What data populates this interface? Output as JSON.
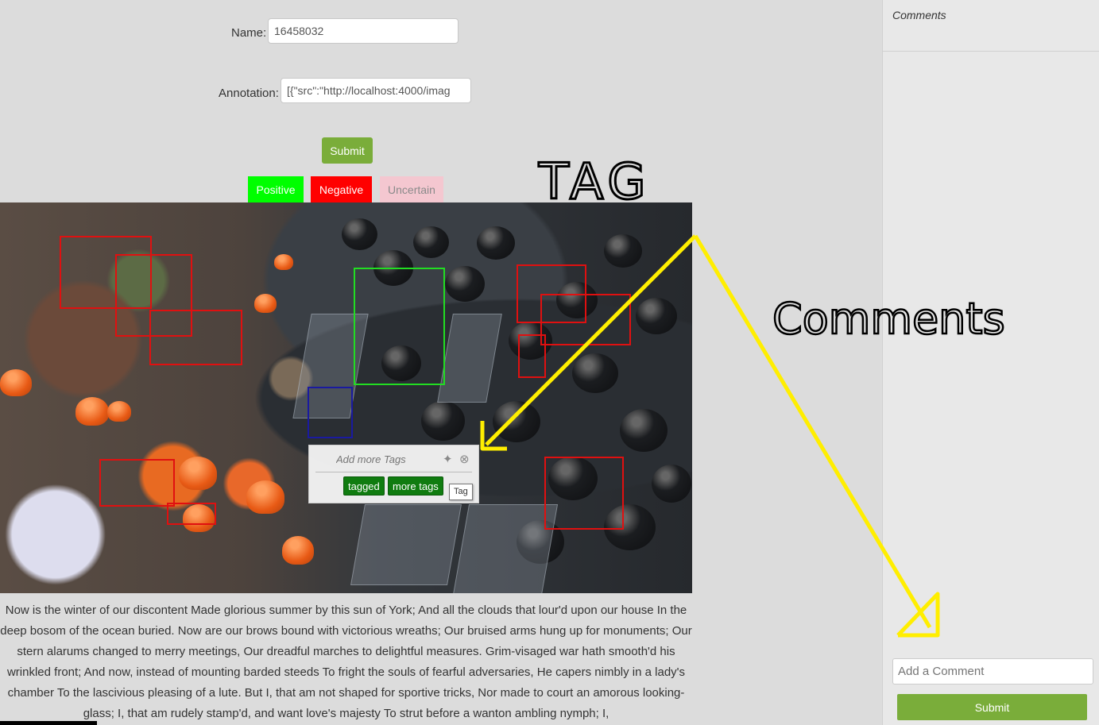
{
  "form": {
    "name_label": "Name:",
    "name_value": "16458032",
    "annotation_label": "Annotation:",
    "annotation_value": "[{\"src\":\"http://localhost:4000/imag",
    "submit_label": "Submit"
  },
  "sentiment": {
    "positive_label": "Positive",
    "negative_label": "Negative",
    "uncertain_label": "Uncertain",
    "positive_color": "#00ff00",
    "negative_color": "#ff0000",
    "uncertain_color": "#f4c7d0"
  },
  "tag_popup": {
    "placeholder": "Add more Tags",
    "tags": [
      "tagged",
      "more tags"
    ],
    "tooltip": "Tag",
    "tag_color": "#107c10"
  },
  "story": {
    "text": "Now is the winter of our discontent Made glorious summer by this sun of York; And all the clouds that lour'd upon our house In the deep bosom of the ocean buried. Now are our brows bound with victorious wreaths; Our bruised arms hung up for monuments; Our stern alarums changed to merry meetings, Our dreadful marches to delightful measures. Grim-visaged war hath smooth'd his wrinkled front; And now, instead of mounting barded steeds To fright the souls of fearful adversaries, He capers nimbly in a lady's chamber To the lascivious pleasing of a lute. But I, that am not shaped for sportive tricks, Nor made to court an amorous looking-glass; I, that am rudely stamp'd, and want love's majesty To strut before a wanton ambling nymph; I,"
  },
  "sidebar": {
    "title": "Comments",
    "comment_placeholder": "Add a Comment",
    "submit_label": "Submit"
  },
  "annotations": {
    "tag_label": "TAG",
    "comments_label": "Comments",
    "arrow_color": "#ffee00"
  },
  "colors": {
    "accent_green": "#7aad3a",
    "box_red": "#e01010",
    "box_green": "#22dd22",
    "box_blue": "#1a1aa0"
  }
}
